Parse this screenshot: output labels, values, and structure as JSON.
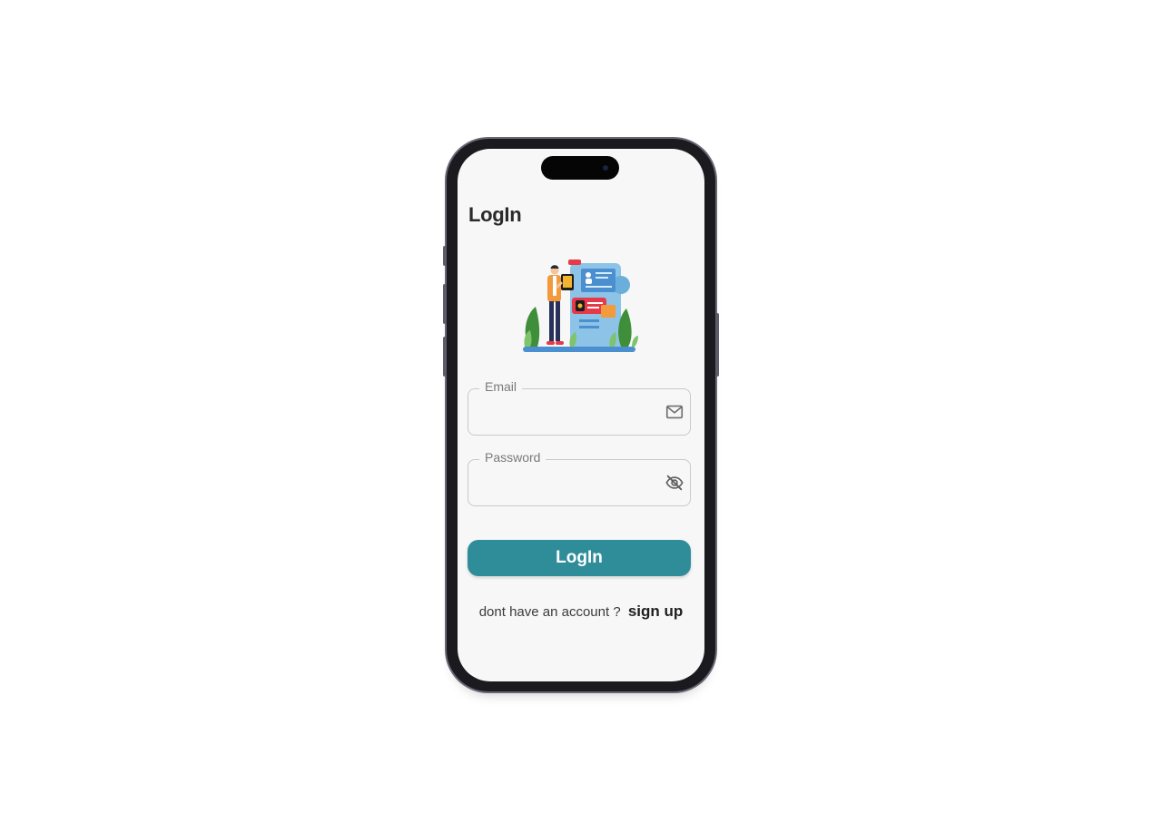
{
  "screen": {
    "title": "LogIn"
  },
  "form": {
    "email": {
      "label": "Email",
      "value": "",
      "icon": "mail-icon"
    },
    "password": {
      "label": "Password",
      "value": "",
      "icon": "eye-off-icon"
    },
    "submit_label": "LogIn"
  },
  "footer": {
    "prompt": "dont have an account ?",
    "link_label": "sign up"
  },
  "colors": {
    "accent": "#2f8d9a",
    "screen_background": "#f7f7f7",
    "field_border": "#c9c9c9",
    "phone_frame": "#1a1a1f"
  }
}
